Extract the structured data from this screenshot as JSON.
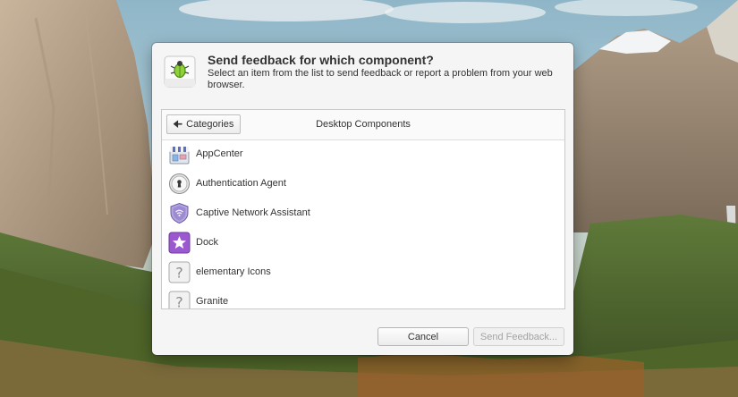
{
  "dialog": {
    "title": "Send feedback for which component?",
    "subtitle": "Select an item from the list to send feedback or report a problem from your web browser.",
    "app_icon": "feedback-bug-icon"
  },
  "list": {
    "back_label": "Categories",
    "back_icon": "arrow-left-icon",
    "heading": "Desktop Components",
    "items": [
      {
        "label": "AppCenter",
        "icon": "appcenter-icon"
      },
      {
        "label": "Authentication Agent",
        "icon": "keyhole-icon"
      },
      {
        "label": "Captive Network Assistant",
        "icon": "shield-icon"
      },
      {
        "label": "Dock",
        "icon": "star-icon"
      },
      {
        "label": "elementary Icons",
        "icon": "question-icon"
      },
      {
        "label": "Granite",
        "icon": "question-icon"
      }
    ]
  },
  "buttons": {
    "cancel": "Cancel",
    "send": "Send Feedback..."
  },
  "colors": {
    "accent_green": "#76b82a",
    "dock_purple": "#9b59d0",
    "shield_purple": "#8e7cc3"
  }
}
